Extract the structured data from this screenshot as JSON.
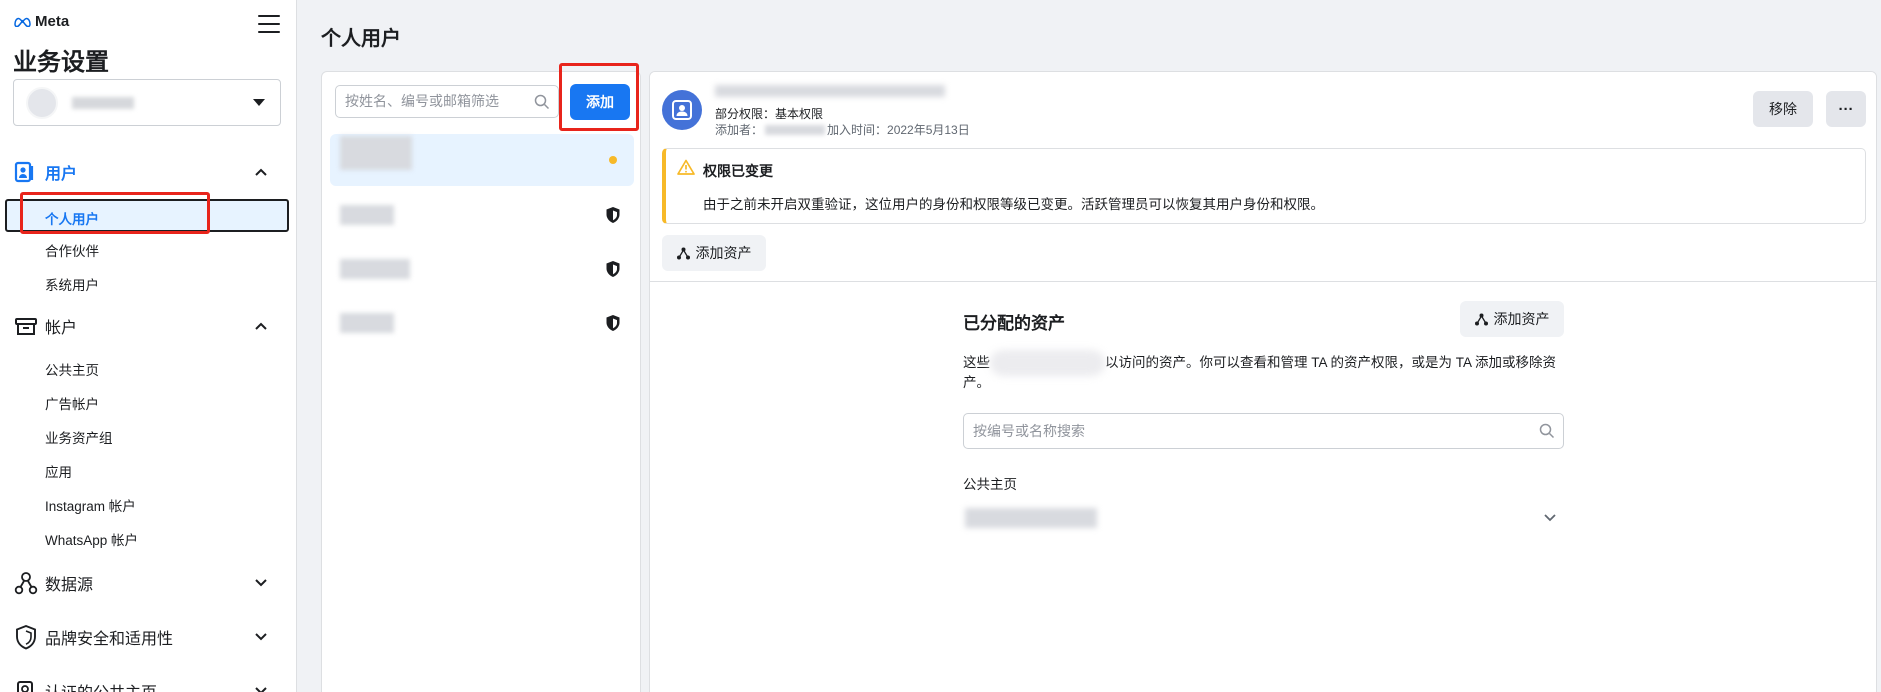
{
  "brand": {
    "logo_text": "Meta"
  },
  "sidebar": {
    "title": "业务设置",
    "groups": {
      "users": {
        "label": "用户",
        "items": {
          "people": "个人用户",
          "partners": "合作伙伴",
          "system_users": "系统用户"
        }
      },
      "accounts": {
        "label": "帐户",
        "items": {
          "pages": "公共主页",
          "ad_accounts": "广告帐户",
          "asset_groups": "业务资产组",
          "apps": "应用",
          "instagram": "Instagram 帐户",
          "whatsapp": "WhatsApp 帐户"
        }
      },
      "data_sources": {
        "label": "数据源"
      },
      "brand_safety": {
        "label": "品牌安全和适用性"
      },
      "verified_pages": {
        "label": "认证的公共主页"
      }
    }
  },
  "main": {
    "title": "个人用户"
  },
  "user_list": {
    "search_placeholder": "按姓名、编号或邮箱筛选",
    "add_label": "添加"
  },
  "detail": {
    "permission_line": "部分权限：基本权限",
    "added_by_label": "添加者：",
    "added_time": "加入时间：2022年5月13日",
    "remove_label": "移除",
    "more_label": "···",
    "warning": {
      "title": "权限已变更",
      "body": "由于之前未开启双重验证，这位用户的身份和权限等级已变更。活跃管理员可以恢复其用户身份和权限。"
    },
    "add_asset_label": "添加资产",
    "assets": {
      "title": "已分配的资产",
      "add_label": "添加资产",
      "desc_prefix": "这些",
      "desc_suffix": "以访问的资产。你可以查看和管理 TA 的资产权限，或是为 TA 添加或移除资产。",
      "search_placeholder": "按编号或名称搜索",
      "pages_label": "公共主页"
    }
  },
  "colors": {
    "accent": "#1877f2",
    "highlight": "#e8241b",
    "warning": "#f7b928"
  }
}
